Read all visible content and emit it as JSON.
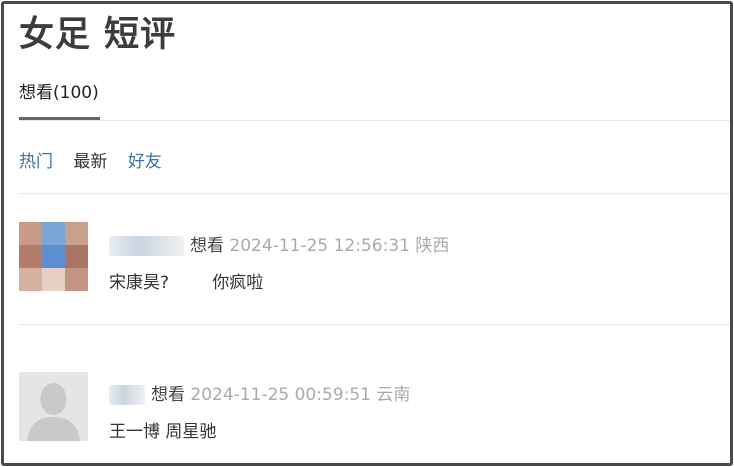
{
  "page": {
    "title": "女足 短评",
    "tab": "想看(100)",
    "filters": [
      "热门",
      "最新",
      "好友"
    ]
  },
  "comments": [
    {
      "rating": "想看",
      "time": "2024-11-25 12:56:31",
      "location": "陕西",
      "content": "宋康昊?        你疯啦"
    },
    {
      "rating": "想看",
      "time": "2024-11-25 00:59:51",
      "location": "云南",
      "content": "王一博 周星驰"
    }
  ],
  "colors": {
    "link": "#3a74a6",
    "muted": "#aaaaaa",
    "text": "#333333"
  }
}
